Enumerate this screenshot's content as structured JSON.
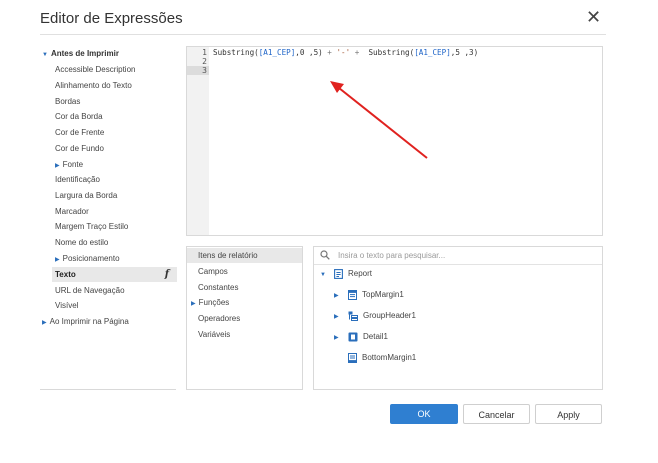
{
  "dialog": {
    "title": "Editor de Expressões",
    "close_icon": "close-icon"
  },
  "tree": {
    "root": "Antes de Imprimir",
    "items": [
      "Accessible Description",
      "Alinhamento do Texto",
      "Bordas",
      "Cor da Borda",
      "Cor de Frente",
      "Cor de Fundo",
      "Fonte",
      "Identificação",
      "Largura da Borda",
      "Marcador",
      "Margem Traço Estilo",
      "Nome do estilo",
      "Posicionamento",
      "Texto",
      "URL de Navegação",
      "Visível"
    ],
    "selected": "Texto",
    "selected_icon": "function-icon",
    "second_root": "Ao Imprimir na Página"
  },
  "editor": {
    "line_numbers": [
      "1",
      "2",
      "3"
    ],
    "line1": {
      "t1": "Substring(",
      "t2": "[A1_CEP]",
      "t3": ",0 ,5)",
      "t4": " + ",
      "t5": "'-'",
      "t6": " + ",
      "t7": " Substring(",
      "t8": "[A1_CEP]",
      "t9": ",5 ,3)"
    }
  },
  "categories": {
    "items": [
      "Itens de relatório",
      "Campos",
      "Constantes",
      "Funções",
      "Operadores",
      "Variáveis"
    ],
    "selected": "Itens de relatório"
  },
  "fields": {
    "search_placeholder": "Insira o texto para pesquisar...",
    "root": "Report",
    "children": [
      "TopMargin1",
      "GroupHeader1",
      "Detail1",
      "BottomMargin1"
    ]
  },
  "buttons": {
    "ok": "OK",
    "cancel": "Cancelar",
    "apply": "Apply"
  },
  "colors": {
    "accent": "#2f7fd1",
    "annotation_arrow": "#e0221f"
  }
}
